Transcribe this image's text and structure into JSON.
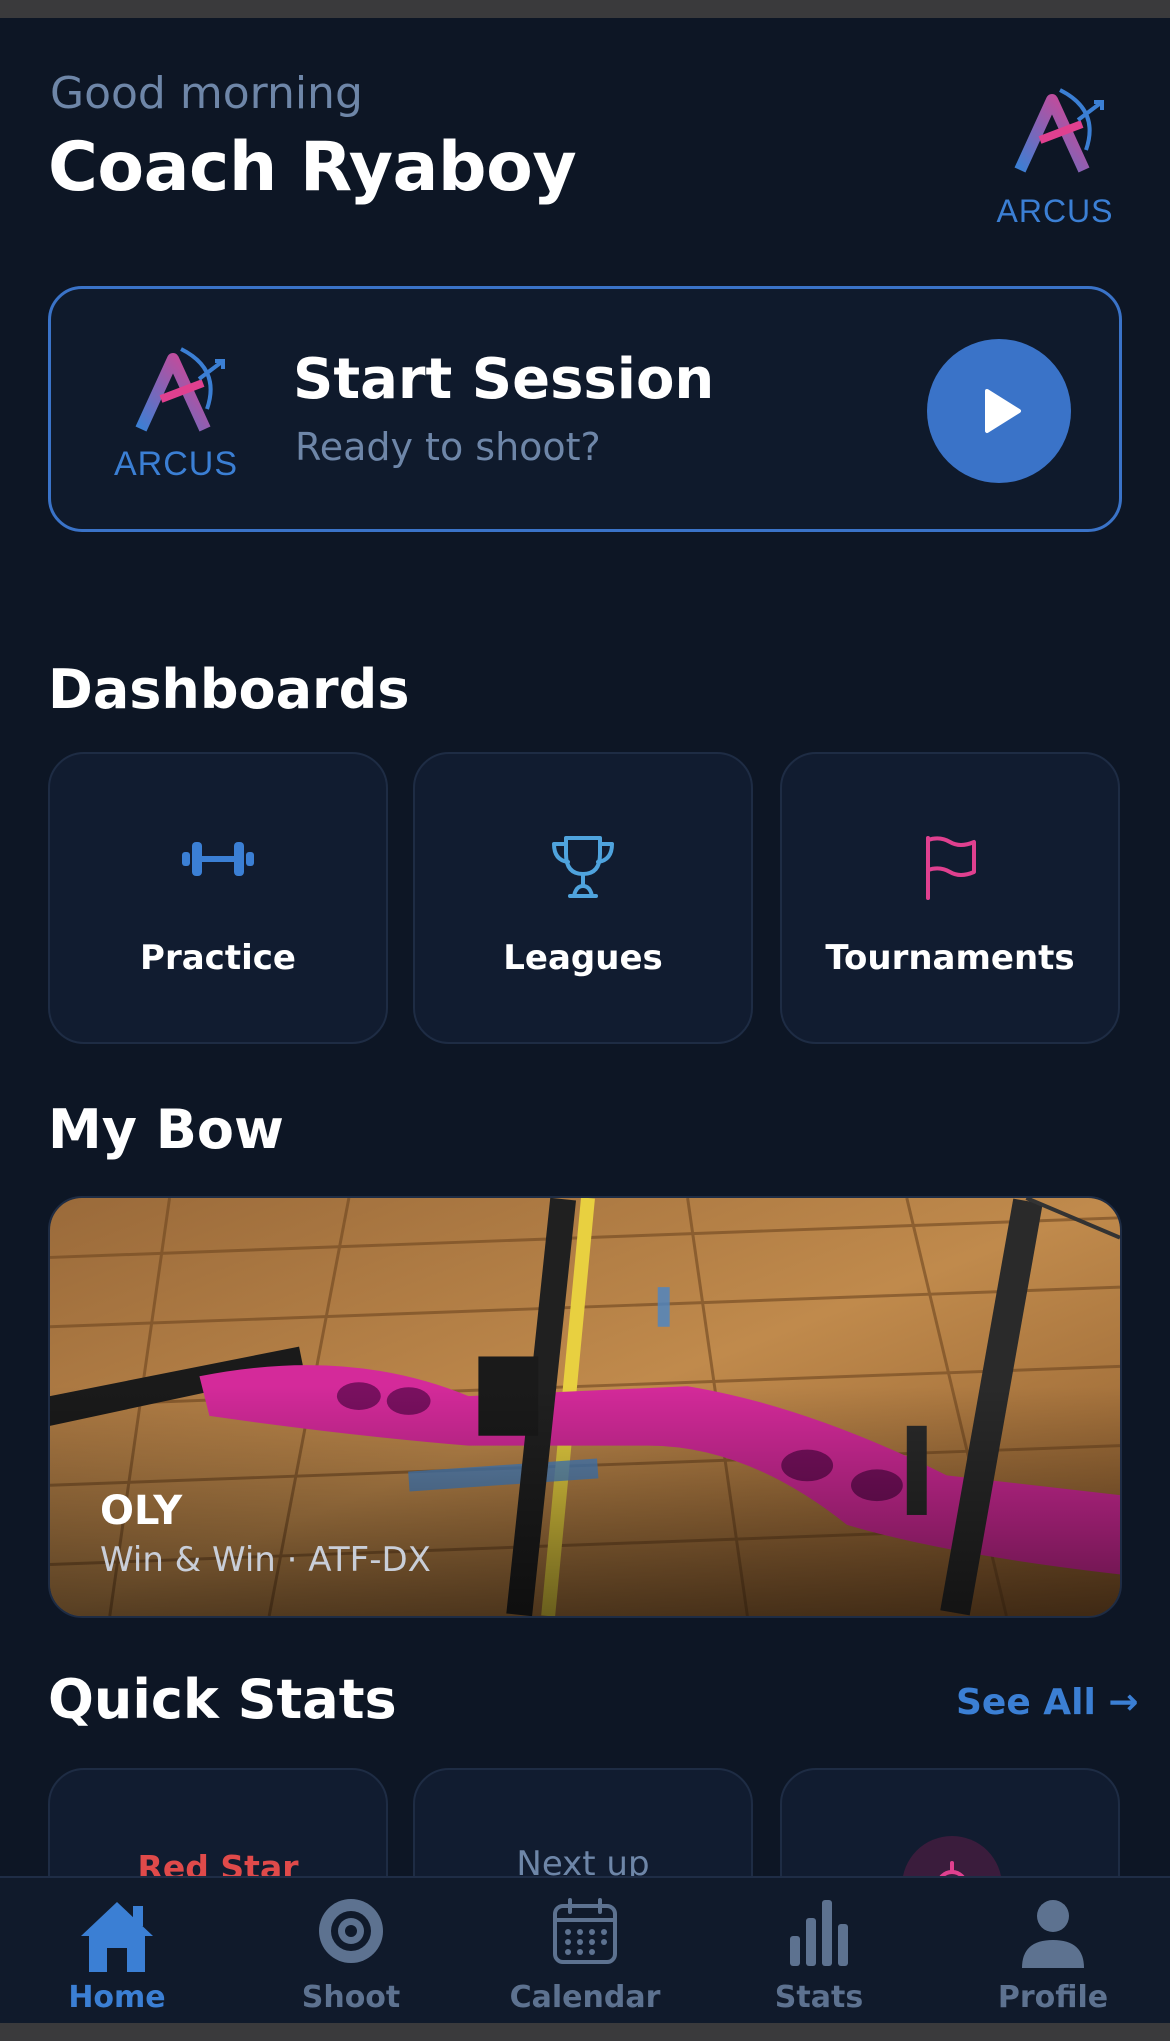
{
  "header": {
    "greeting": "Good morning",
    "name": "Coach Ryaboy",
    "logo_text": "ARCUS"
  },
  "session": {
    "logo_text": "ARCUS",
    "title": "Start Session",
    "subtitle": "Ready to shoot?",
    "play_icon": "play-icon"
  },
  "dashboards": {
    "title": "Dashboards",
    "tiles": [
      {
        "label": "Practice",
        "icon": "dumbbell-icon"
      },
      {
        "label": "Leagues",
        "icon": "trophy-icon"
      },
      {
        "label": "Tournaments",
        "icon": "flag-icon"
      }
    ]
  },
  "bow": {
    "title": "My Bow",
    "name": "OLY",
    "detail": "Win & Win · ATF-DX"
  },
  "quick_stats": {
    "title": "Quick Stats",
    "see_all": "See All →",
    "cards": [
      {
        "label": "Red Star"
      },
      {
        "label": "Next up"
      },
      {
        "icon": "target-icon"
      }
    ]
  },
  "tab_bar": {
    "active": "Home",
    "tabs": [
      {
        "label": "Home",
        "icon": "home-icon"
      },
      {
        "label": "Shoot",
        "icon": "target-icon"
      },
      {
        "label": "Calendar",
        "icon": "calendar-icon"
      },
      {
        "label": "Stats",
        "icon": "bar-chart-icon"
      },
      {
        "label": "Profile",
        "icon": "person-icon"
      }
    ]
  },
  "colors": {
    "background": "#0d1625",
    "accent": "#3a73c8",
    "muted_text": "#6e86a8",
    "pink": "#e0408f",
    "red": "#e04a4a"
  }
}
